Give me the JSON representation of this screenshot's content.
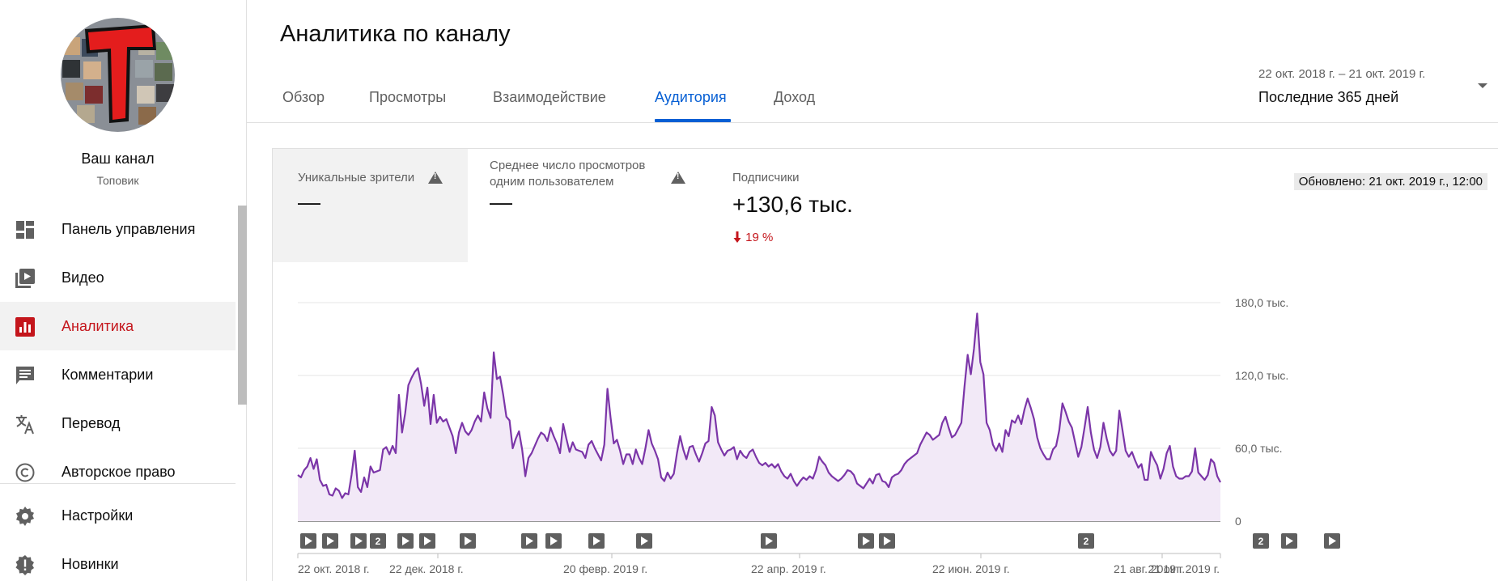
{
  "sidebar": {
    "channel_name": "Ваш канал",
    "channel_subtitle": "Топовик",
    "items": [
      {
        "label": "Панель управления",
        "icon": "dashboard-icon",
        "active": false
      },
      {
        "label": "Видео",
        "icon": "video-library-icon",
        "active": false
      },
      {
        "label": "Аналитика",
        "icon": "analytics-icon",
        "active": true
      },
      {
        "label": "Комментарии",
        "icon": "comment-icon",
        "active": false
      },
      {
        "label": "Перевод",
        "icon": "translate-icon",
        "active": false
      },
      {
        "label": "Авторское право",
        "icon": "copyright-icon",
        "active": false
      },
      {
        "label": "Настройки",
        "icon": "gear-icon",
        "active": false
      },
      {
        "label": "Новинки",
        "icon": "new-badge-icon",
        "active": false
      }
    ]
  },
  "header": {
    "title": "Аналитика по каналу",
    "tabs": [
      {
        "label": "Обзор"
      },
      {
        "label": "Просмотры"
      },
      {
        "label": "Взаимодействие"
      },
      {
        "label": "Аудитория",
        "active": true
      },
      {
        "label": "Доход"
      }
    ],
    "date_range": "22 окт. 2018 г. – 21 окт. 2019 г.",
    "date_label": "Последние 365 дней"
  },
  "metrics": {
    "unique_viewers": {
      "label": "Уникальные зрители",
      "value": "—"
    },
    "avg_views": {
      "label_line1": "Среднее число просмотров",
      "label_line2": "одним пользователем",
      "value": "—"
    },
    "subscribers": {
      "label": "Подписчики",
      "value": "+130,6 тыс.",
      "delta": "19 %",
      "delta_direction": "down"
    },
    "updated": "Обновлено: 21 окт. 2019 г., 12:00"
  },
  "colors": {
    "accent": "#065fd4",
    "active_red": "#c4161c",
    "series": "#7b35a8",
    "series_fill": "#f2e9f7"
  },
  "chart_data": {
    "type": "area",
    "ylim": [
      0,
      180000
    ],
    "y_ticks": [
      "180,0 тыс.",
      "120,0 тыс.",
      "60,0 тыс.",
      "0"
    ],
    "y_tick_values": [
      180000,
      120000,
      60000,
      0
    ],
    "x_labels": [
      "22 окт. 2018 г.",
      "22 дек. 2018 г.",
      "20 февр. 2019 г.",
      "22 апр. 2019 г.",
      "22 июн. 2019 г.",
      "21 авг. 2019 г.",
      "21 окт. 2019 г."
    ],
    "grid": true,
    "series": [
      {
        "values": [
          38000,
          36000,
          42000,
          45000,
          52000,
          43000,
          51000,
          34000,
          29000,
          30000,
          22000,
          21000,
          27000,
          25000,
          19000,
          23000,
          22000,
          38000,
          58000,
          28000,
          24000,
          36000,
          28000,
          45000,
          40000,
          41000,
          42000,
          59000,
          61000,
          55000,
          62000,
          56000,
          104000,
          73000,
          89000,
          112000,
          118000,
          123000,
          126000,
          113000,
          95000,
          110000,
          80000,
          104000,
          81000,
          86000,
          82000,
          84000,
          77000,
          70000,
          56000,
          73000,
          81000,
          74000,
          71000,
          75000,
          82000,
          87000,
          82000,
          106000,
          93000,
          85000,
          139000,
          117000,
          119000,
          104000,
          86000,
          83000,
          60000,
          68000,
          74000,
          59000,
          37000,
          52000,
          56000,
          62000,
          68000,
          73000,
          71000,
          66000,
          77000,
          70000,
          64000,
          56000,
          80000,
          68000,
          57000,
          65000,
          59000,
          58000,
          57000,
          52000,
          63000,
          66000,
          60000,
          55000,
          50000,
          63000,
          109000,
          85000,
          64000,
          67000,
          58000,
          47000,
          55000,
          55000,
          47000,
          59000,
          52000,
          47000,
          60000,
          75000,
          64000,
          58000,
          51000,
          36000,
          33000,
          40000,
          35000,
          39000,
          56000,
          70000,
          59000,
          51000,
          61000,
          62000,
          55000,
          49000,
          56000,
          64000,
          66000,
          94000,
          87000,
          65000,
          59000,
          54000,
          58000,
          59000,
          61000,
          51000,
          58000,
          54000,
          52000,
          57000,
          59000,
          53000,
          48000,
          46000,
          48000,
          45000,
          47000,
          44000,
          47000,
          41000,
          37000,
          35000,
          39000,
          33000,
          29000,
          33000,
          36000,
          34000,
          37000,
          35000,
          42000,
          53000,
          49000,
          46000,
          40000,
          37000,
          35000,
          33000,
          35000,
          38000,
          42000,
          41000,
          38000,
          31000,
          29000,
          27000,
          31000,
          35000,
          31000,
          38000,
          39000,
          33000,
          32000,
          28000,
          36000,
          38000,
          39000,
          42000,
          47000,
          50000,
          52000,
          54000,
          56000,
          63000,
          68000,
          73000,
          71000,
          67000,
          69000,
          71000,
          81000,
          86000,
          77000,
          69000,
          71000,
          76000,
          81000,
          111000,
          137000,
          121000,
          142000,
          171000,
          131000,
          121000,
          81000,
          75000,
          63000,
          58000,
          64000,
          57000,
          75000,
          70000,
          83000,
          81000,
          87000,
          80000,
          92000,
          101000,
          93000,
          84000,
          69000,
          60000,
          55000,
          51000,
          51000,
          59000,
          62000,
          75000,
          97000,
          90000,
          82000,
          77000,
          65000,
          53000,
          61000,
          77000,
          94000,
          73000,
          59000,
          52000,
          61000,
          81000,
          68000,
          58000,
          54000,
          58000,
          91000,
          75000,
          58000,
          53000,
          57000,
          50000,
          44000,
          47000,
          34000,
          34000,
          57000,
          51000,
          46000,
          35000,
          43000,
          56000,
          62000,
          45000,
          37000,
          35000,
          35000,
          37000,
          37000,
          41000,
          60000,
          40000,
          37000,
          34000,
          38000,
          51000,
          48000,
          37000,
          32000
        ]
      }
    ],
    "event_markers": [
      {
        "kind": "video"
      },
      {
        "kind": "video"
      },
      {
        "kind": "video"
      },
      {
        "kind": "count",
        "label": "2"
      },
      {
        "kind": "video"
      },
      {
        "kind": "video"
      },
      {
        "kind": "video"
      },
      {
        "kind": "video"
      },
      {
        "kind": "video"
      },
      {
        "kind": "video"
      },
      {
        "kind": "video"
      },
      {
        "kind": "video"
      },
      {
        "kind": "video"
      },
      {
        "kind": "video"
      },
      {
        "kind": "count",
        "label": "2"
      },
      {
        "kind": "count",
        "label": "2"
      },
      {
        "kind": "video"
      },
      {
        "kind": "video"
      }
    ]
  }
}
